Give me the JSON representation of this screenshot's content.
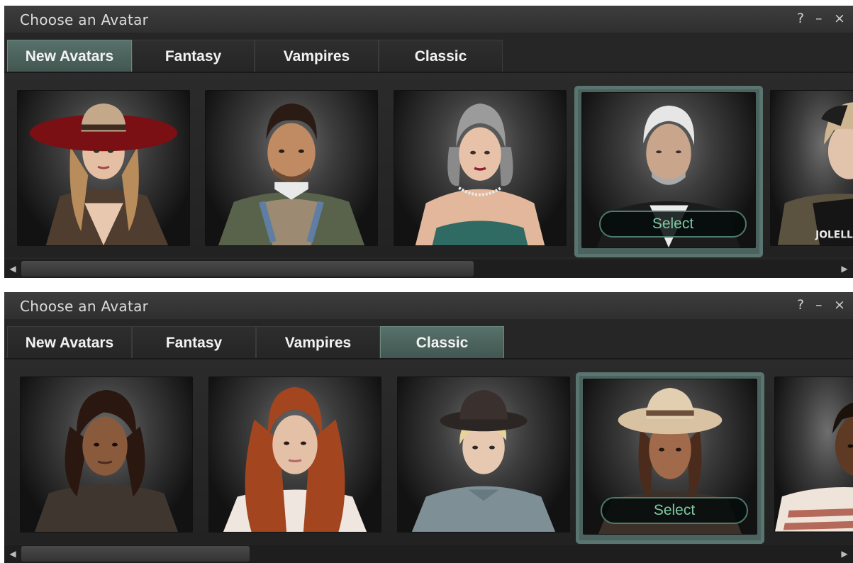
{
  "window_title": "Choose an Avatar",
  "controls": {
    "help": "?",
    "minimize": "–",
    "close": "×"
  },
  "button_select": "Select",
  "panel_top": {
    "tabs": [
      "New Avatars",
      "Fantasy",
      "Vampires",
      "Classic"
    ],
    "active_tab": "New Avatars",
    "shirt_text": "JOLELL"
  },
  "panel_bottom": {
    "tabs": [
      "New Avatars",
      "Fantasy",
      "Vampires",
      "Classic"
    ],
    "active_tab": "Classic"
  },
  "colors": {
    "accent": "#5a7470",
    "select_text": "#7fc8a6",
    "background": "#262626"
  }
}
